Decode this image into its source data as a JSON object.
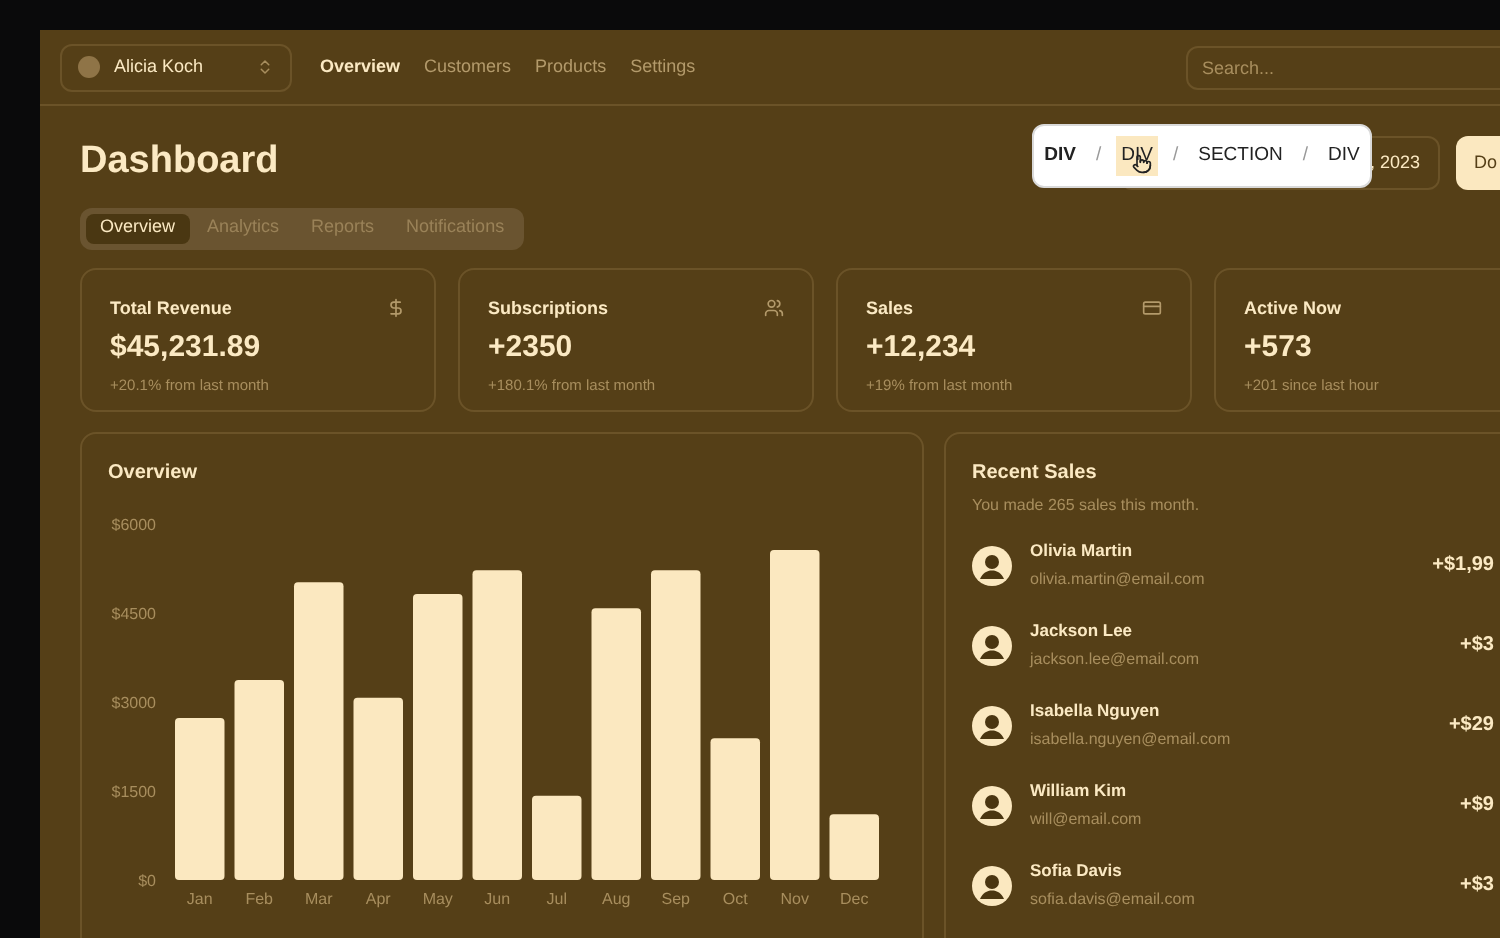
{
  "nav": {
    "team": "Alicia Koch",
    "links": [
      {
        "label": "Overview",
        "selected": true
      },
      {
        "label": "Customers",
        "selected": false
      },
      {
        "label": "Products",
        "selected": false
      },
      {
        "label": "Settings",
        "selected": false
      }
    ],
    "search": {
      "placeholder": "Search..."
    }
  },
  "header": {
    "title": "Dashboard",
    "date_range": ", 2023",
    "download_button": "Do"
  },
  "breadcrumb_popup": {
    "items": [
      {
        "label": "DIV",
        "selected": false,
        "bold": true
      },
      {
        "label": "DIV",
        "selected": true,
        "bold": false
      },
      {
        "label": "SECTION",
        "selected": false,
        "bold": false
      },
      {
        "label": "DIV",
        "selected": false,
        "bold": false
      }
    ],
    "separator": "/"
  },
  "tabs": [
    {
      "label": "Overview",
      "selected": true
    },
    {
      "label": "Analytics",
      "selected": false
    },
    {
      "label": "Reports",
      "selected": false
    },
    {
      "label": "Notifications",
      "selected": false
    }
  ],
  "stats": [
    {
      "kind": "dollar",
      "title": "Total Revenue",
      "value": "$45,231.89",
      "change": "+20.1% from last month"
    },
    {
      "kind": "users",
      "title": "Subscriptions",
      "value": "+2350",
      "change": "+180.1% from last month"
    },
    {
      "kind": "card",
      "title": "Sales",
      "value": "+12,234",
      "change": "+19% from last month"
    },
    {
      "kind": "none",
      "title": "Active Now",
      "value": "+573",
      "change": "+201 since last hour"
    }
  ],
  "overview": {
    "title": "Overview",
    "chart_data": {
      "type": "bar",
      "categories": [
        "Jan",
        "Feb",
        "Mar",
        "Apr",
        "May",
        "Jun",
        "Jul",
        "Aug",
        "Sep",
        "Oct",
        "Nov",
        "Dec"
      ],
      "series": [
        {
          "color": "#fbe8c0",
          "values": [
            2730,
            3370,
            5020,
            3070,
            4820,
            5220,
            1420,
            4580,
            5220,
            2390,
            5560,
            1110
          ]
        }
      ],
      "ylim": [
        0,
        6000
      ],
      "yticks": [
        {
          "value": 0,
          "label": "$0"
        },
        {
          "value": 1500,
          "label": "$1500"
        },
        {
          "value": 3000,
          "label": "$3000"
        },
        {
          "value": 4500,
          "label": "$4500"
        },
        {
          "value": 6000,
          "label": "$6000"
        }
      ]
    }
  },
  "recent_sales": {
    "title": "Recent Sales",
    "subtitle": "You made 265 sales this month.",
    "rows": [
      {
        "name": "Olivia Martin",
        "email": "olivia.martin@email.com",
        "amount": "+$1,99"
      },
      {
        "name": "Jackson Lee",
        "email": "jackson.lee@email.com",
        "amount": "+$3"
      },
      {
        "name": "Isabella Nguyen",
        "email": "isabella.nguyen@email.com",
        "amount": "+$29"
      },
      {
        "name": "William Kim",
        "email": "will@email.com",
        "amount": "+$9"
      },
      {
        "name": "Sofia Davis",
        "email": "sofia.davis@email.com",
        "amount": "+$3"
      }
    ]
  }
}
